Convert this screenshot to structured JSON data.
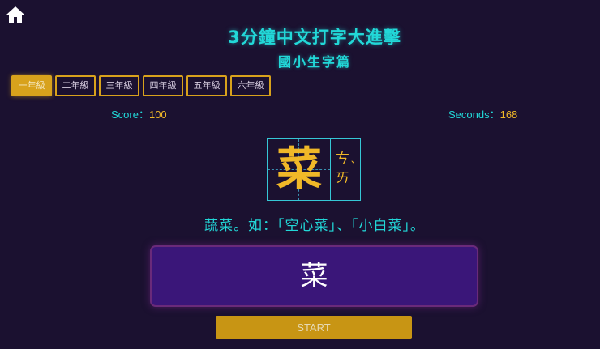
{
  "header": {
    "home_icon": "home-icon",
    "title": "3分鐘中文打字大進擊",
    "subtitle": "國小生字篇"
  },
  "grades": [
    {
      "label": "一年級",
      "active": true
    },
    {
      "label": "二年級",
      "active": false
    },
    {
      "label": "三年級",
      "active": false
    },
    {
      "label": "四年級",
      "active": false
    },
    {
      "label": "五年級",
      "active": false
    },
    {
      "label": "六年級",
      "active": false
    }
  ],
  "status": {
    "score_label": "Score：",
    "score_value": "100",
    "seconds_label": "Seconds：",
    "seconds_value": "168"
  },
  "card": {
    "character": "菜",
    "zhuyin_1": "ㄘ",
    "zhuyin_2": "ㄞ",
    "tone": "ˋ"
  },
  "example": "蔬菜。如：「空心菜」、「小白菜」。",
  "answer": {
    "value": "菜"
  },
  "start_button": "START",
  "colors": {
    "background": "#1b1130",
    "accent_cyan": "#22d8d8",
    "accent_gold": "#d8a21c",
    "answer_bg": "#3a1679"
  }
}
